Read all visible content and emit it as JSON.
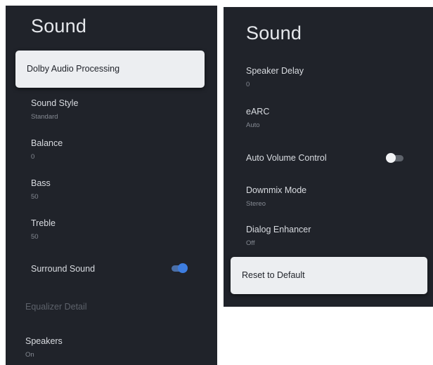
{
  "left_panel": {
    "title": "Sound",
    "focused_item": {
      "label": "Dolby Audio Processing"
    },
    "items": [
      {
        "label": "Sound Style",
        "value": "Standard"
      },
      {
        "label": "Balance",
        "value": "0"
      },
      {
        "label": "Bass",
        "value": "50"
      },
      {
        "label": "Treble",
        "value": "50"
      },
      {
        "label": "Surround Sound",
        "toggle": "on"
      },
      {
        "label": "Equalizer Detail",
        "disabled": true
      },
      {
        "label": "Speakers",
        "value": "On"
      }
    ]
  },
  "right_panel": {
    "title": "Sound",
    "items": [
      {
        "label": "Speaker Delay",
        "value": "0"
      },
      {
        "label": "eARC",
        "value": "Auto"
      },
      {
        "label": "Auto Volume Control",
        "toggle": "off"
      },
      {
        "label": "Downmix Mode",
        "value": "Stereo"
      },
      {
        "label": "Dialog Enhancer",
        "value": "Off"
      }
    ],
    "focused_item": {
      "label": "Reset to Default"
    }
  },
  "colors": {
    "panel_bg": "#20232a",
    "focus_bg": "#eceef1",
    "toggle_on": "#3d7de0",
    "text_primary": "#d9dce1",
    "text_secondary": "#858a93"
  }
}
